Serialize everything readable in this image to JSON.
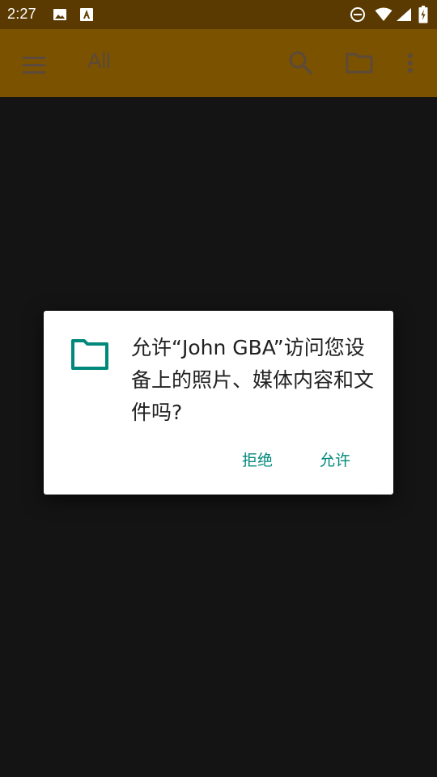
{
  "status_bar": {
    "time": "2:27",
    "icons": [
      "image-icon",
      "text-icon",
      "do-not-disturb-icon",
      "wifi-icon",
      "signal-icon",
      "battery-icon"
    ]
  },
  "app_bar": {
    "title": "All",
    "icons": [
      "menu-icon",
      "search-icon",
      "folder-icon",
      "more-vert-icon"
    ]
  },
  "dialog": {
    "message": "允许“John GBA”访问您设备上的照片、媒体内容和文件吗?",
    "deny_label": "拒绝",
    "allow_label": "允许",
    "icon": "folder-icon"
  },
  "colors": {
    "status_bar": "#5a3a00",
    "app_bar": "#7a5200",
    "background": "#141414",
    "dialog_bg": "#ffffff",
    "accent": "#00897b"
  }
}
